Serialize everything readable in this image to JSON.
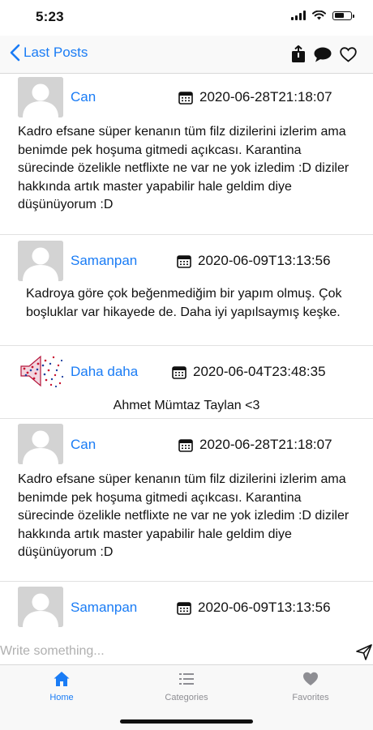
{
  "status_bar": {
    "time": "5:23",
    "battery_level": 0.6
  },
  "nav": {
    "back_label": "Last Posts",
    "actions": [
      "share-icon",
      "comment-icon",
      "heart-outline-icon"
    ]
  },
  "posts": [
    {
      "author": "Can",
      "date": "2020-06-28T21:18:07",
      "body": "Kadro efsane süper kenanın tüm filz dizilerini izlerim ama benimde pek hoşuma gitmedi açıkcası. Karantina sürecinde özelikle netflixte ne var ne yok izledim :D diziler hakkında artık master yapabilir hale geldim diye düşünüyorum :D",
      "avatar": "default-avatar"
    },
    {
      "author": "Samanpan",
      "date": "2020-06-09T13:13:56",
      "body": "Kadroya göre çok beğenmediğim bir yapım olmuş. Çok boşluklar var hikayede de. Daha iyi yapılsaymış keşke.",
      "avatar": "default-avatar"
    },
    {
      "author": "Daha daha",
      "date": "2020-06-04T23:48:35",
      "body": "Ahmet Mümtaz Taylan <3",
      "avatar": "stars-megaphone-avatar"
    },
    {
      "author": "Can",
      "date": "2020-06-28T21:18:07",
      "body": "Kadro efsane süper kenanın tüm filz dizilerini izlerim ama benimde pek hoşuma gitmedi açıkcası. Karantina sürecinde özelikle netflixte ne var ne yok izledim :D diziler hakkında artık master yapabilir hale geldim diye düşünüyorum :D",
      "avatar": "default-avatar"
    },
    {
      "author": "Samanpan",
      "date": "2020-06-09T13:13:56",
      "body": "",
      "avatar": "default-avatar"
    }
  ],
  "composer": {
    "placeholder": "Write something...",
    "value": ""
  },
  "tabs": [
    {
      "label": "Home",
      "icon": "home-icon",
      "active": true
    },
    {
      "label": "Categories",
      "icon": "list-icon",
      "active": false
    },
    {
      "label": "Favorites",
      "icon": "heart-icon",
      "active": false
    }
  ],
  "colors": {
    "accent": "#1a7cf5",
    "inactive_tab": "#8e8e93",
    "separator": "#e1e1e1"
  }
}
